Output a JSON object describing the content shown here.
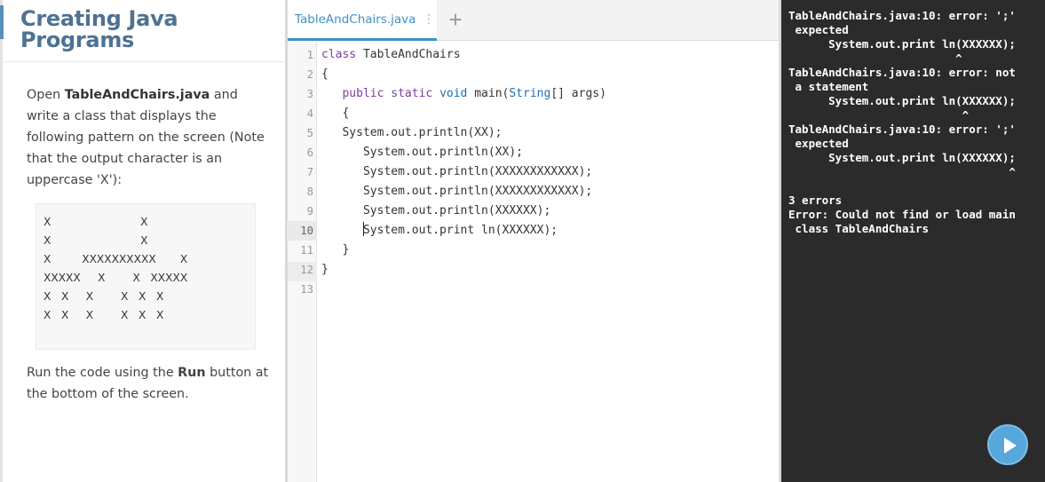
{
  "instructions": {
    "title": "Creating Java Programs",
    "desc_1": "Open ",
    "desc_file": "TableAndChairs.java",
    "desc_2": " and write a class that displays the following pattern on the screen (Note that the output character is an uppercase 'X'):",
    "pattern": "X                          X\nX                          X\nX         XXXXXXXXXX       X\nXXXXX     X        X   XXXXX\nX   X     X        X   X   X\nX   X     X        X   X   X",
    "run_1": "Run the code using the ",
    "run_bold": "Run",
    "run_2": " button at the bottom of the screen."
  },
  "editor": {
    "tab_label": "TableAndChairs.java",
    "tab_menu_icon": "⋮",
    "add_tab_icon": "+",
    "active_line": 10,
    "lines": [
      {
        "n": "1",
        "text": "class TableAndChairs"
      },
      {
        "n": "2",
        "text": "{"
      },
      {
        "n": "3",
        "text": "   public static void main(String[] args)"
      },
      {
        "n": "4",
        "text": "   {"
      },
      {
        "n": "5",
        "text": "   System.out.println(XX);"
      },
      {
        "n": "6",
        "text": "      System.out.println(XX);"
      },
      {
        "n": "7",
        "text": "      System.out.println(XXXXXXXXXXXX);"
      },
      {
        "n": "8",
        "text": "      System.out.println(XXXXXXXXXXXX);"
      },
      {
        "n": "9",
        "text": "      System.out.println(XXXXXX);"
      },
      {
        "n": "10",
        "text": "      System.out.print ln(XXXXXX);"
      },
      {
        "n": "11",
        "text": "   }"
      },
      {
        "n": "12",
        "text": "}"
      },
      {
        "n": "13",
        "text": ""
      }
    ]
  },
  "console": {
    "output": "TableAndChairs.java:10: error: ';'\n expected\n      System.out.print ln(XXXXXX);\n                         ^\nTableAndChairs.java:10: error: not\n a statement\n      System.out.print ln(XXXXXX);\n                          ^\nTableAndChairs.java:10: error: ';'\n expected\n      System.out.print ln(XXXXXX);\n                                 ^\n\n3 errors\nError: Could not find or load main\n class TableAndChairs"
  },
  "run_button": {
    "icon": "play-icon",
    "color": "#56a7dc"
  }
}
